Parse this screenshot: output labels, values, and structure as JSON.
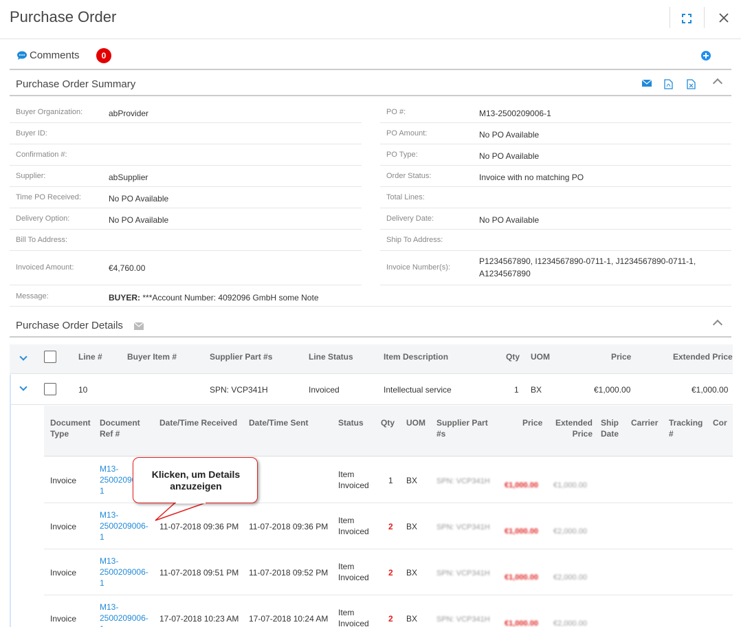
{
  "window": {
    "title": "Purchase Order"
  },
  "comments": {
    "label": "Comments",
    "count": "0"
  },
  "summary": {
    "title": "Purchase Order Summary",
    "left": [
      {
        "k": "Buyer Organization:",
        "v": "abProvider"
      },
      {
        "k": "Buyer ID:",
        "v": ""
      },
      {
        "k": "Confirmation #:",
        "v": ""
      },
      {
        "k": "Supplier:",
        "v": "abSupplier"
      },
      {
        "k": "Time PO Received:",
        "v": "No PO Available"
      },
      {
        "k": "Delivery Option:",
        "v": "No PO Available"
      },
      {
        "k": "Bill To Address:",
        "v": ""
      },
      {
        "k": "Invoiced Amount:",
        "v": "€4,760.00"
      }
    ],
    "right": [
      {
        "k": "PO #:",
        "v": "M13-2500209006-1"
      },
      {
        "k": "PO Amount:",
        "v": "No PO Available"
      },
      {
        "k": "PO Type:",
        "v": "No PO Available"
      },
      {
        "k": "Order Status:",
        "v": "Invoice with no matching PO"
      },
      {
        "k": "Total Lines:",
        "v": ""
      },
      {
        "k": "Delivery Date:",
        "v": "No PO Available"
      },
      {
        "k": "Ship To Address:",
        "v": ""
      },
      {
        "k": "Invoice Number(s):",
        "v1": "P1234567890, I1234567890-0711-1, J1234567890-0711-1,",
        "v2": "A1234567890"
      }
    ],
    "message": {
      "k": "Message:",
      "prefix": "BUYER:",
      "text": "***Account Number: 4092096 GmbH some Note"
    }
  },
  "details": {
    "title": "Purchase Order Details",
    "columns": [
      "Line #",
      "Buyer Item #",
      "Supplier Part #s",
      "Line Status",
      "Item Description",
      "Qty",
      "UOM",
      "Price",
      "Extended Price"
    ],
    "line": {
      "line": "10",
      "buyer_item": "",
      "supplier_part": "SPN: VCP341H",
      "status": "Invoiced",
      "description": "Intellectual service",
      "qty": "1",
      "uom": "BX",
      "price": "€1,000.00",
      "ext": "€1,000.00"
    }
  },
  "docs": {
    "columns": {
      "doc_type_1": "Document",
      "doc_type_2": "Type",
      "doc_ref_1": "Document",
      "doc_ref_2": "Ref #",
      "received": "Date/Time Received",
      "sent": "Date/Time Sent",
      "status": "Status",
      "qty": "Qty",
      "uom": "UOM",
      "spn_1": "Supplier Part",
      "spn_2": "#s",
      "price": "Price",
      "ext_1": "Extended",
      "ext_2": "Price",
      "ship_1": "Ship",
      "ship_2": "Date",
      "carrier": "Carrier",
      "track_1": "Tracking",
      "track_2": "#",
      "cor": "Cor"
    },
    "rows": [
      {
        "type": "Invoice",
        "ref1": "M13-",
        "ref2": "250020900",
        "ref3": "1",
        "received": "",
        "sent": "",
        "status1": "Item",
        "status2": "Invoiced",
        "qty": "1",
        "uom": "BX",
        "spn": "SPN: VCP341H",
        "price": "€1,000.00",
        "ext": "€1,000.00"
      },
      {
        "type": "Invoice",
        "ref1": "M13-",
        "ref2": "2500209006-",
        "ref3": "1",
        "received": "11-07-2018 09:36 PM",
        "sent": "11-07-2018 09:36 PM",
        "status1": "Item",
        "status2": "Invoiced",
        "qty": "2",
        "uom": "BX",
        "spn": "SPN: VCP341H",
        "price": "€1,000.00",
        "ext": "€2,000.00"
      },
      {
        "type": "Invoice",
        "ref1": "M13-",
        "ref2": "2500209006-",
        "ref3": "1",
        "received": "11-07-2018 09:51 PM",
        "sent": "11-07-2018 09:52 PM",
        "status1": "Item",
        "status2": "Invoiced",
        "qty": "2",
        "uom": "BX",
        "spn": "SPN: VCP341H",
        "price": "€1,000.00",
        "ext": "€2,000.00"
      },
      {
        "type": "Invoice",
        "ref1": "M13-",
        "ref2": "2500209006-",
        "ref3": "1",
        "received": "17-07-2018 10:23 AM",
        "sent": "17-07-2018 10:24 AM",
        "status1": "Item",
        "status2": "Invoiced",
        "qty": "2",
        "uom": "BX",
        "spn": "SPN: VCP341H",
        "price": "€1,000.00",
        "ext": "€2,000.00"
      }
    ]
  },
  "callout": {
    "line1": "Klicken, um Details",
    "line2": "anzuzeigen"
  },
  "icons": {
    "accent": "#1f8ad9",
    "badge": "#e30000"
  }
}
